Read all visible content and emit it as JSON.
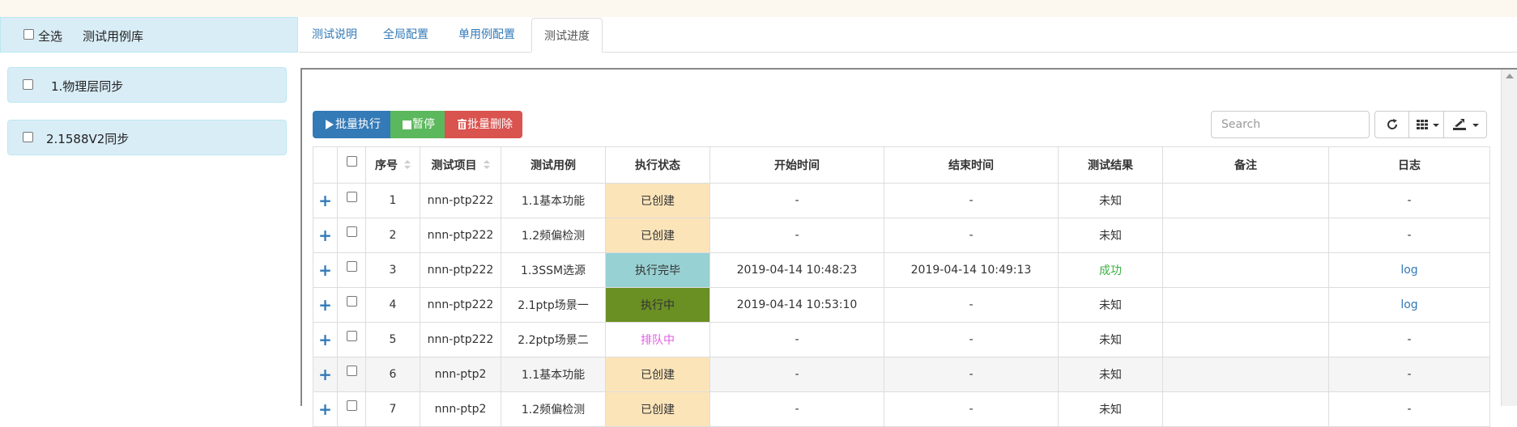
{
  "sidebar": {
    "select_all_label": "全选",
    "title": "测试用例库",
    "items": [
      {
        "label": "1.物理层同步"
      },
      {
        "label": "2.1588V2同步"
      }
    ]
  },
  "tabs": [
    {
      "label": "测试说明"
    },
    {
      "label": "全局配置"
    },
    {
      "label": "单用例配置"
    },
    {
      "label": "测试进度",
      "active": true
    }
  ],
  "toolbar": {
    "exec_label": "批量执行",
    "pause_label": "暂停",
    "delete_label": "批量删除",
    "search_placeholder": "Search"
  },
  "table": {
    "headers": [
      "序号",
      "测试项目",
      "测试用例",
      "执行状态",
      "开始时间",
      "结束时间",
      "测试结果",
      "备注",
      "日志"
    ],
    "rows": [
      {
        "no": "1",
        "project": "nnn-ptp222",
        "case": "1.1基本功能",
        "status": "已创建",
        "start": "-",
        "end": "-",
        "result": "未知",
        "note": "",
        "log": "-"
      },
      {
        "no": "2",
        "project": "nnn-ptp222",
        "case": "1.2频偏检测",
        "status": "已创建",
        "start": "-",
        "end": "-",
        "result": "未知",
        "note": "",
        "log": "-"
      },
      {
        "no": "3",
        "project": "nnn-ptp222",
        "case": "1.3SSM选源",
        "status": "执行完毕",
        "start": "2019-04-14 10:48:23",
        "end": "2019-04-14 10:49:13",
        "result": "成功",
        "note": "",
        "log": "log"
      },
      {
        "no": "4",
        "project": "nnn-ptp222",
        "case": "2.1ptp场景一",
        "status": "执行中",
        "start": "2019-04-14 10:53:10",
        "end": "-",
        "result": "未知",
        "note": "",
        "log": "log"
      },
      {
        "no": "5",
        "project": "nnn-ptp222",
        "case": "2.2ptp场景二",
        "status": "排队中",
        "start": "-",
        "end": "-",
        "result": "未知",
        "note": "",
        "log": "-"
      },
      {
        "no": "6",
        "project": "nnn-ptp2",
        "case": "1.1基本功能",
        "status": "已创建",
        "start": "-",
        "end": "-",
        "result": "未知",
        "note": "",
        "log": "-"
      },
      {
        "no": "7",
        "project": "nnn-ptp2",
        "case": "1.2频偏检测",
        "status": "已创建",
        "start": "-",
        "end": "-",
        "result": "未知",
        "note": "",
        "log": "-"
      }
    ]
  },
  "colors": {
    "primary": "#337ab7",
    "success": "#5cb85c",
    "danger": "#d9534f",
    "status_created": "#fce4b9",
    "status_done": "#98d1d3",
    "status_running": "#6a8f23",
    "status_queue_text": "#e05ee0",
    "result_success": "#3cb043"
  }
}
